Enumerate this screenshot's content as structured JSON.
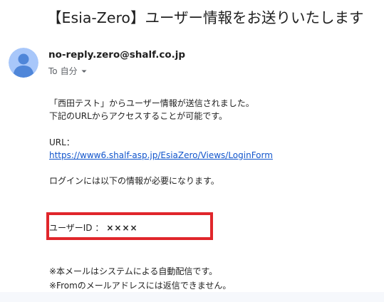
{
  "email": {
    "subject": "【Esia-Zero】ユーザー情報をお送りいたします",
    "sender": "no-reply.zero@shalf.co.jp",
    "recipient_label": "To",
    "recipient": "自分",
    "body": {
      "line1": "「西田テスト」からユーザー情報が送信されました。",
      "line2": "下記のURLからアクセスすることが可能です。",
      "url_label": "URL：",
      "url": "https://www6.shalf-asp.jp/EsiaZero/Views/LoginForm",
      "login_info": "ログインには以下の情報が必要になります。",
      "userid_label": "ユーザーID ：",
      "userid_value": "××××",
      "note1": "※本メールはシステムによる自動配信です。",
      "note2": "※Fromのメールアドレスには返信できません。"
    }
  },
  "colors": {
    "link": "#1155cc",
    "highlight_border": "#e0262b",
    "avatar_bg": "#a8c7fa",
    "avatar_fg": "#4f86d9"
  },
  "icons": {
    "avatar": "default-user-avatar",
    "chevron": "chevron-down-icon"
  }
}
